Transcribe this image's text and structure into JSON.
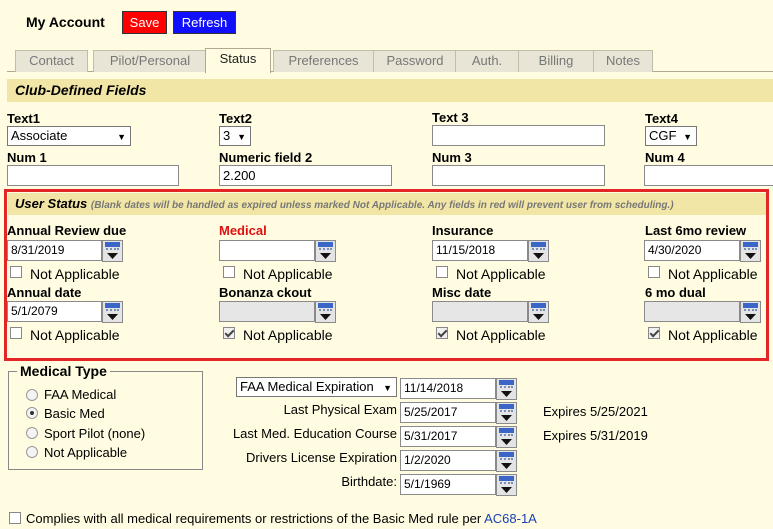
{
  "header": {
    "title": "My Account",
    "save_label": "Save",
    "refresh_label": "Refresh"
  },
  "tabs": [
    "Contact",
    "Pilot/Personal",
    "Status",
    "Preferences",
    "Password",
    "Auth.",
    "Billing",
    "Notes"
  ],
  "club_fields": {
    "title": "Club-Defined Fields",
    "text1": {
      "label": "Text1",
      "value": "Associate"
    },
    "text2": {
      "label": "Text2",
      "value": "3"
    },
    "text3": {
      "label": "Text 3",
      "value": ""
    },
    "text4": {
      "label": "Text4",
      "value": "CGF"
    },
    "num1": {
      "label": "Num 1",
      "value": ""
    },
    "num2": {
      "label": "Numeric field 2",
      "value": "2.200"
    },
    "num3": {
      "label": "Num 3",
      "value": ""
    },
    "num4": {
      "label": "Num 4",
      "value": ""
    }
  },
  "user_status": {
    "title": "User Status",
    "note": "(Blank dates will be handled as expired unless marked Not Applicable.  Any fields in red will prevent user from scheduling.)",
    "na_label": "Not Applicable",
    "fields": [
      {
        "label": "Annual Review due",
        "value": "8/31/2019",
        "na": false,
        "red": false
      },
      {
        "label": "Medical",
        "value": "",
        "na": false,
        "red": true
      },
      {
        "label": "Insurance",
        "value": "11/15/2018",
        "na": false,
        "red": false
      },
      {
        "label": "Last 6mo review",
        "value": "4/30/2020",
        "na": false,
        "red": false
      },
      {
        "label": "Annual date",
        "value": "5/1/2079",
        "na": false,
        "red": false
      },
      {
        "label": "Bonanza ckout",
        "value": "",
        "na": true,
        "red": false
      },
      {
        "label": "Misc date",
        "value": "",
        "na": true,
        "red": false
      },
      {
        "label": "6 mo dual",
        "value": "",
        "na": true,
        "red": false
      }
    ]
  },
  "medical_type": {
    "legend": "Medical Type",
    "options": [
      "FAA Medical",
      "Basic Med",
      "Sport Pilot (none)",
      "Not Applicable"
    ],
    "selected": "Basic Med"
  },
  "medical_dates": {
    "expiration_select": "FAA Medical Expiration",
    "expiration_value": "11/14/2018",
    "last_physical_label": "Last Physical Exam",
    "last_physical_value": "5/25/2017",
    "last_physical_expires": "Expires 5/25/2021",
    "last_med_ed_label": "Last Med. Education Course",
    "last_med_ed_value": "5/31/2017",
    "last_med_ed_expires": "Expires 5/31/2019",
    "dl_label": "Drivers License Expiration",
    "dl_value": "1/2/2020",
    "birthdate_label": "Birthdate:",
    "birthdate_value": "5/1/1969"
  },
  "compliance": {
    "text": "Complies with all medical requirements or restrictions of the Basic Med rule per",
    "link": "AC68-1A"
  }
}
